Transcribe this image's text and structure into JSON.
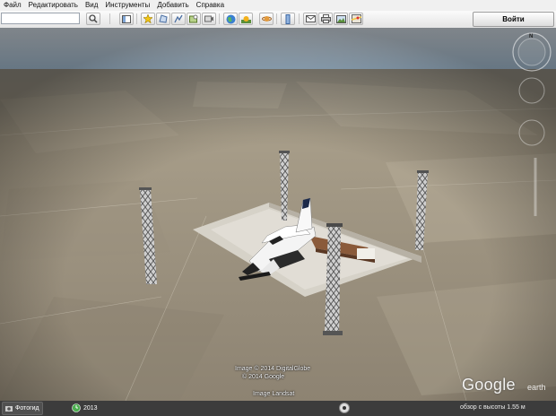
{
  "menu": {
    "file": "Файл",
    "edit": "Редактировать",
    "view": "Вид",
    "tools": "Инструменты",
    "add": "Добавить",
    "help": "Справка"
  },
  "toolbar": {
    "search_value": "",
    "login_label": "Войти",
    "icons": [
      "search-icon",
      "sidebar-icon",
      "placemark-icon",
      "polygon-icon",
      "path-icon",
      "overlay-icon",
      "tour-icon",
      "earth-icon",
      "sun-icon",
      "planets-icon",
      "ruler-icon",
      "email-icon",
      "print-icon",
      "save-image-icon",
      "maps-icon"
    ]
  },
  "navigation": {
    "compass_north": "N"
  },
  "scene": {
    "copyright_line1": "Image © 2014 DigitalGlobe",
    "copyright_line2": "© 2014 Google",
    "copyright_line3": "Image Landsat",
    "logo_text": "Google",
    "logo_suffix": "earth"
  },
  "statusbar": {
    "photo_tour": "Фотогид",
    "year": "2013",
    "altitude_text": "обзор с высоты  1.55 м"
  },
  "colors": {
    "sky_top": "#e8f2fb",
    "ground": "#a59986",
    "statusbar": "#3c3c3c"
  }
}
